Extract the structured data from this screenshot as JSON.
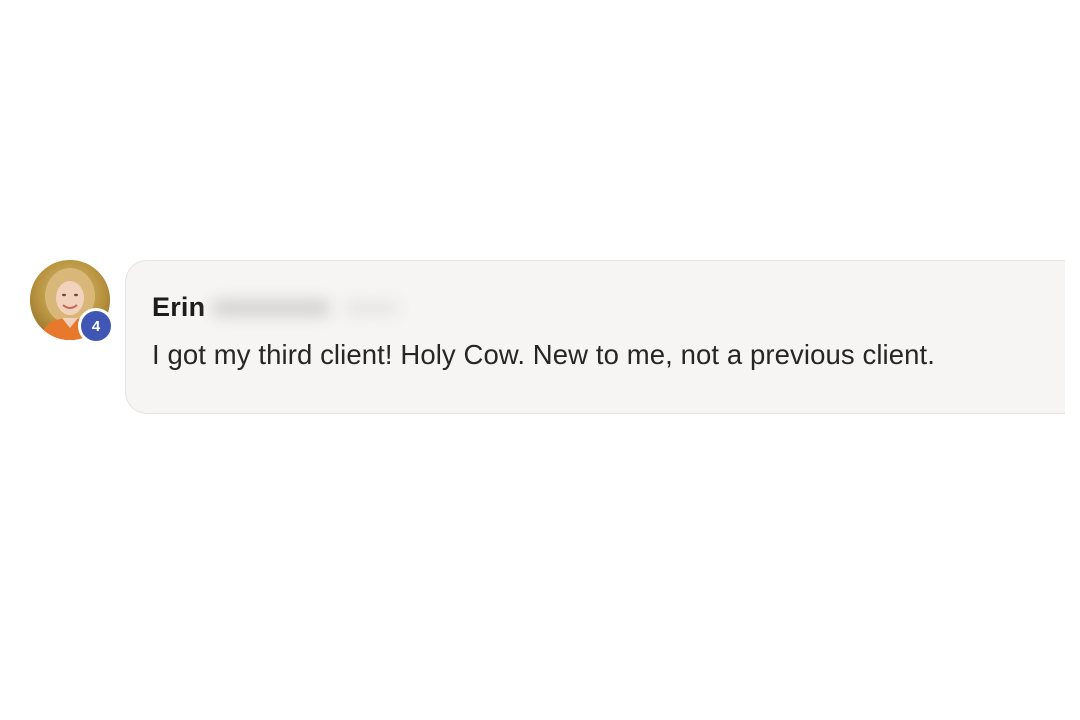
{
  "comment": {
    "author_first_name": "Erin",
    "author_last_name_redacted": true,
    "badge_count": "4",
    "message": "I got my third client! Holy Cow. New to me, not a previous client."
  },
  "colors": {
    "badge": "#3f56b5",
    "bubble_background": "#f6f5f4",
    "text": "#262626"
  },
  "icons": {
    "avatar": "profile-photo"
  }
}
